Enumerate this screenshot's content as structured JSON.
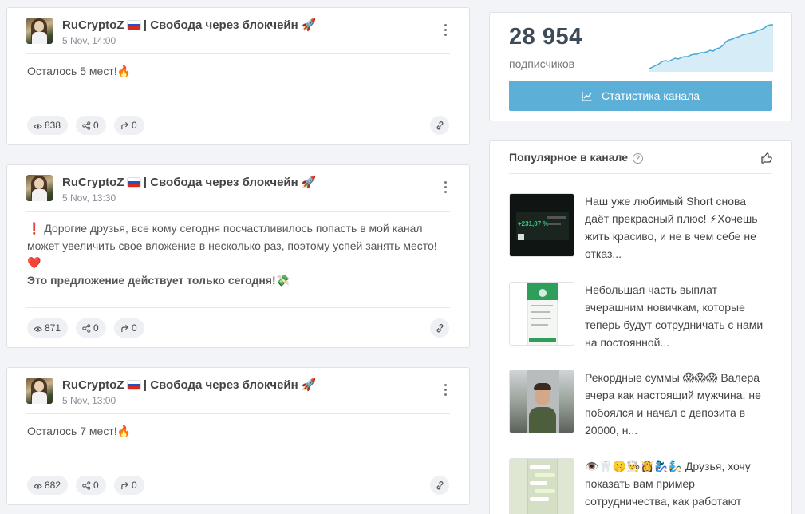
{
  "channel": {
    "name": "RuCryptoZ",
    "title_suffix": " | Свобода через блокчейн 🚀"
  },
  "posts": [
    {
      "date": "5 Nov, 14:00",
      "text": "Осталось 5 мест!🔥",
      "views": "838",
      "shares": "0",
      "forwards": "0"
    },
    {
      "date": "5 Nov, 13:30",
      "line1": "❗ Дорогие друзья, все кому сегодня посчастливилось попасть в мой канал",
      "line2": "может увеличить свое вложение в несколько раз, поэтому успей занять место!",
      "line3": "❤️",
      "line4": "Это предложение действует только сегодня!💸",
      "views": "871",
      "shares": "0",
      "forwards": "0"
    },
    {
      "date": "5 Nov, 13:00",
      "text": "Осталось 7 мест!🔥",
      "views": "882",
      "shares": "0",
      "forwards": "0"
    }
  ],
  "stats": {
    "subscribers": "28 954",
    "subscribers_label": "подписчиков",
    "button_label": "Статистика канала"
  },
  "popular": {
    "title": "Популярное в канале",
    "help_glyph": "?",
    "items": [
      {
        "text": "Наш уже любимый Short снова даёт прекрасный плюс! ⚡Хочешь жить красиво, и не в чем себе не отказ...",
        "thumb_value": "+231,07 %"
      },
      {
        "text": "Небольшая часть выплат вчерашним новичкам, которые теперь будут сотрудничать с нами на постоянной..."
      },
      {
        "text": "Рекордные суммы 😱😱😱 Валера вчера как настоящий мужчина, не побоялся и начал с депозита в 20000, н..."
      },
      {
        "text": "👁️🦷🤫👨‍🍳👸🧞‍♀️🧞 Друзья, хочу показать вам пример сотрудничества, как работают"
      }
    ]
  },
  "colors": {
    "accent": "#5cafd6",
    "sparkline_stroke": "#4aa8d4",
    "sparkline_fill": "#d6ecf6"
  }
}
